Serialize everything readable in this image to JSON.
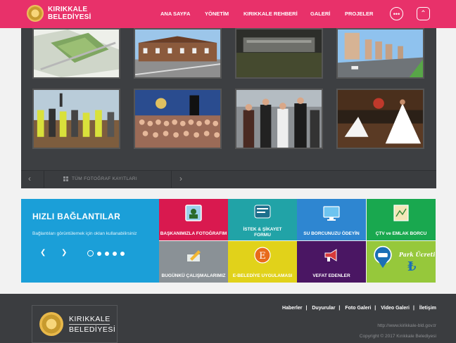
{
  "header": {
    "logo_line1": "KIRIKKALE",
    "logo_line2": "BELEDİYESİ",
    "nav": [
      "ANA SAYFA",
      "YÖNETİM",
      "KIRIKKALE REHBERİ",
      "GALERİ",
      "PROJELER"
    ],
    "more_icon": "ellipsis-icon",
    "up_icon": "chevron-up-icon",
    "color": "#e8316a"
  },
  "gallery": {
    "all_photos_label": "TÜM FOTOĞRAF KAYITLARI",
    "prev_icon": "chevron-left-icon",
    "next_icon": "chevron-right-icon"
  },
  "quick_links": {
    "title": "HIZLI BAĞLANTILAR",
    "subtitle": "Bağlantıları görüntülemek için oklan kullanabilirsiniz",
    "tiles": [
      {
        "label": "BAŞKANIMIZLA FOTOĞRAFIM",
        "color": "#d9194f"
      },
      {
        "label": "İSTEK & ŞİKAYET FORMU",
        "color": "#21a3a7"
      },
      {
        "label": "SU BORCUNUZU ÖDEYİN",
        "color": "#2e86d1"
      },
      {
        "label": "ÇTV ve EMLAK BORCU",
        "color": "#19a84f"
      },
      {
        "label": "BUGÜNKÜ ÇALIŞMALARIMIZ",
        "color": "#8a9196"
      },
      {
        "label": "E-BELEDİYE UYGULAMASI",
        "color": "#e1d21a"
      },
      {
        "label": "VEFAT EDENLER",
        "color": "#4a1663"
      },
      {
        "label": "Park Ücreti",
        "color": "#96c83b"
      }
    ]
  },
  "footer": {
    "logo_line1": "KIRIKKALE",
    "logo_line2": "BELEDİYESİ",
    "links": [
      "Haberler",
      "Duyurular",
      "Foto Galeri",
      "Video Galeri",
      "İletişim"
    ],
    "url": "http://www.kirikkale-bld.gov.tr",
    "copyright": "Copyright © 2017 Kırıkkale Belediyesi"
  }
}
